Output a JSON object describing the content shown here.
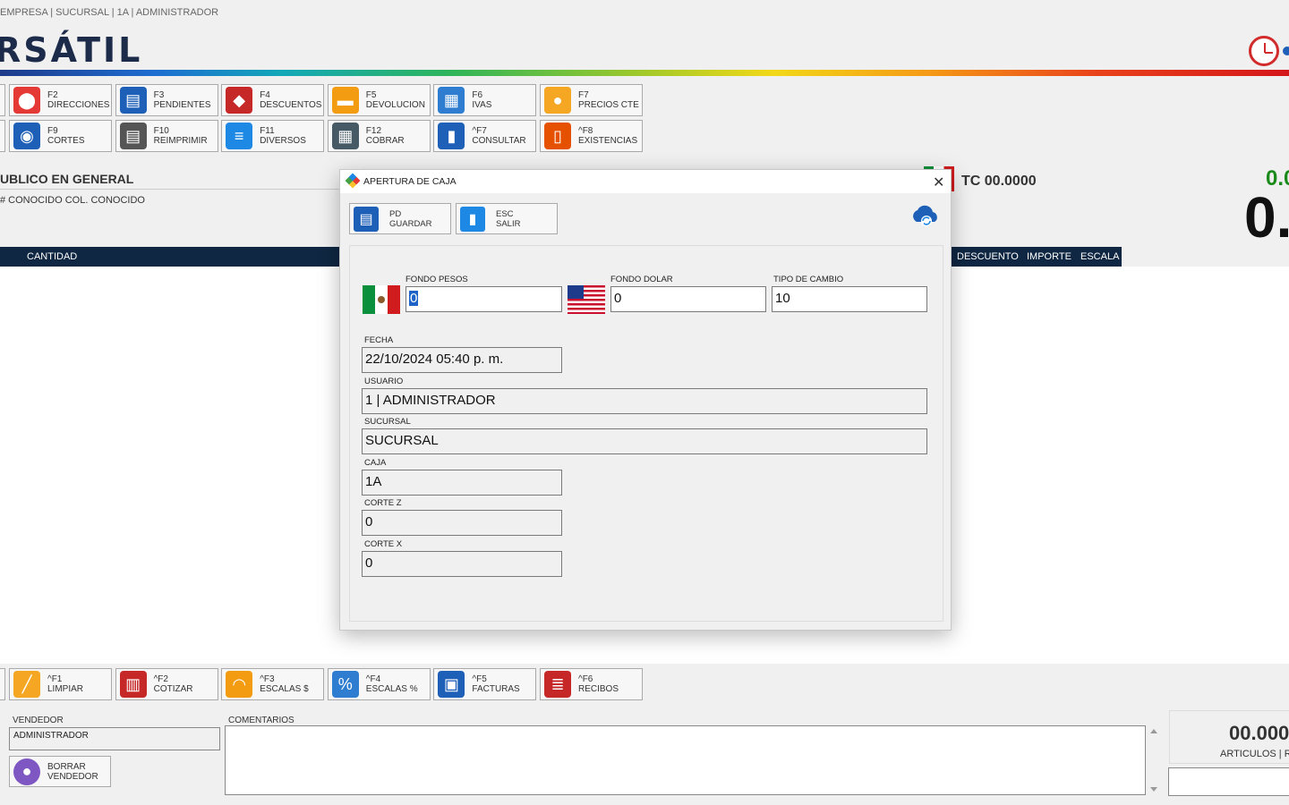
{
  "app": {
    "breadcrumb": "EMPRESA | SUCURSAL | 1A | ADMINISTRADOR",
    "logo_text": "RSÁTIL"
  },
  "toolbar_top": [
    {
      "key": "F2",
      "label": "DIRECCIONES",
      "icon": "map-pin-icon",
      "color": "#e53935"
    },
    {
      "key": "F3",
      "label": "PENDIENTES",
      "icon": "save-disk-icon",
      "color": "#1e5fb8"
    },
    {
      "key": "F4",
      "label": "DESCUENTOS",
      "icon": "price-tag-icon",
      "color": "#c62828"
    },
    {
      "key": "F5",
      "label": "DEVOLUCION",
      "icon": "return-box-icon",
      "color": "#f39c12"
    },
    {
      "key": "F6",
      "label": "IVAS",
      "icon": "tax-document-icon",
      "color": "#2e7dd1"
    },
    {
      "key": "F7",
      "label": "PRECIOS CTE",
      "icon": "price-hand-icon",
      "color": "#f5a623"
    }
  ],
  "toolbar_second": [
    {
      "key": "F9",
      "label": "CORTES",
      "icon": "globe-cut-icon",
      "color": "#1e5fb8"
    },
    {
      "key": "F10",
      "label": "REIMPRIMIR",
      "icon": "printer-disk-icon",
      "color": "#555555"
    },
    {
      "key": "F11",
      "label": "DIVERSOS",
      "icon": "list-icon",
      "color": "#1e88e5"
    },
    {
      "key": "F12",
      "label": "COBRAR",
      "icon": "calculator-icon",
      "color": "#455a64"
    },
    {
      "key": "^F7",
      "label": "CONSULTAR",
      "icon": "barcode-scanner-icon",
      "color": "#1e5fb8"
    },
    {
      "key": "^F8",
      "label": "EXISTENCIAS",
      "icon": "inventory-door-icon",
      "color": "#e65100"
    }
  ],
  "client": {
    "name": "UBLICO EN GENERAL",
    "address": "# CONOCIDO  COL. CONOCIDO"
  },
  "exchange": {
    "tc_label": "TC 00.0000",
    "total_small": "0.0",
    "total_big": "0."
  },
  "grid": {
    "columns_left": [
      "CANTIDAD"
    ],
    "columns_right": [
      "DESCUENTO",
      "IMPORTE",
      "ESCALA"
    ]
  },
  "toolbar_bottom": [
    {
      "key": "^F1",
      "label": "LIMPIAR",
      "icon": "broom-icon",
      "color": "#f5a623"
    },
    {
      "key": "^F2",
      "label": "COTIZAR",
      "icon": "quote-sheet-icon",
      "color": "#c62828"
    },
    {
      "key": "^F3",
      "label": "ESCALAS $",
      "icon": "gauge-icon",
      "color": "#f39c12"
    },
    {
      "key": "^F4",
      "label": "ESCALAS %",
      "icon": "percent-tag-icon",
      "color": "#2e7dd1"
    },
    {
      "key": "^F5",
      "label": "FACTURAS",
      "icon": "invoice-monitor-icon",
      "color": "#1e5fb8"
    },
    {
      "key": "^F6",
      "label": "RECIBOS",
      "icon": "receipt-icon",
      "color": "#c62828"
    }
  ],
  "footer": {
    "vendedor_label": "VENDEDOR",
    "vendedor_value": "ADMINISTRADOR",
    "borrar_key": "BORRAR",
    "borrar_label": "VENDEDOR",
    "comentarios_label": "COMENTARIOS",
    "summary_value": "00.000",
    "summary_label": "ARTICULOS | R"
  },
  "dialog": {
    "title": "APERTURA DE CAJA",
    "guardar_key": "PD",
    "guardar_label": "GUARDAR",
    "salir_key": "ESC",
    "salir_label": "SALIR",
    "fondo_pesos_label": "FONDO PESOS",
    "fondo_pesos_value": "0",
    "fondo_dolar_label": "FONDO DOLAR",
    "fondo_dolar_value": "0",
    "tipo_cambio_label": "TIPO DE CAMBIO",
    "tipo_cambio_value": "10",
    "fecha_label": "FECHA",
    "fecha_value": "22/10/2024 05:40 p. m.",
    "usuario_label": "USUARIO",
    "usuario_value": "1 | ADMINISTRADOR",
    "sucursal_label": "SUCURSAL",
    "sucursal_value": "SUCURSAL",
    "caja_label": "CAJA",
    "caja_value": "1A",
    "corte_z_label": "CORTE Z",
    "corte_z_value": "0",
    "corte_x_label": "CORTE X",
    "corte_x_value": "0"
  }
}
